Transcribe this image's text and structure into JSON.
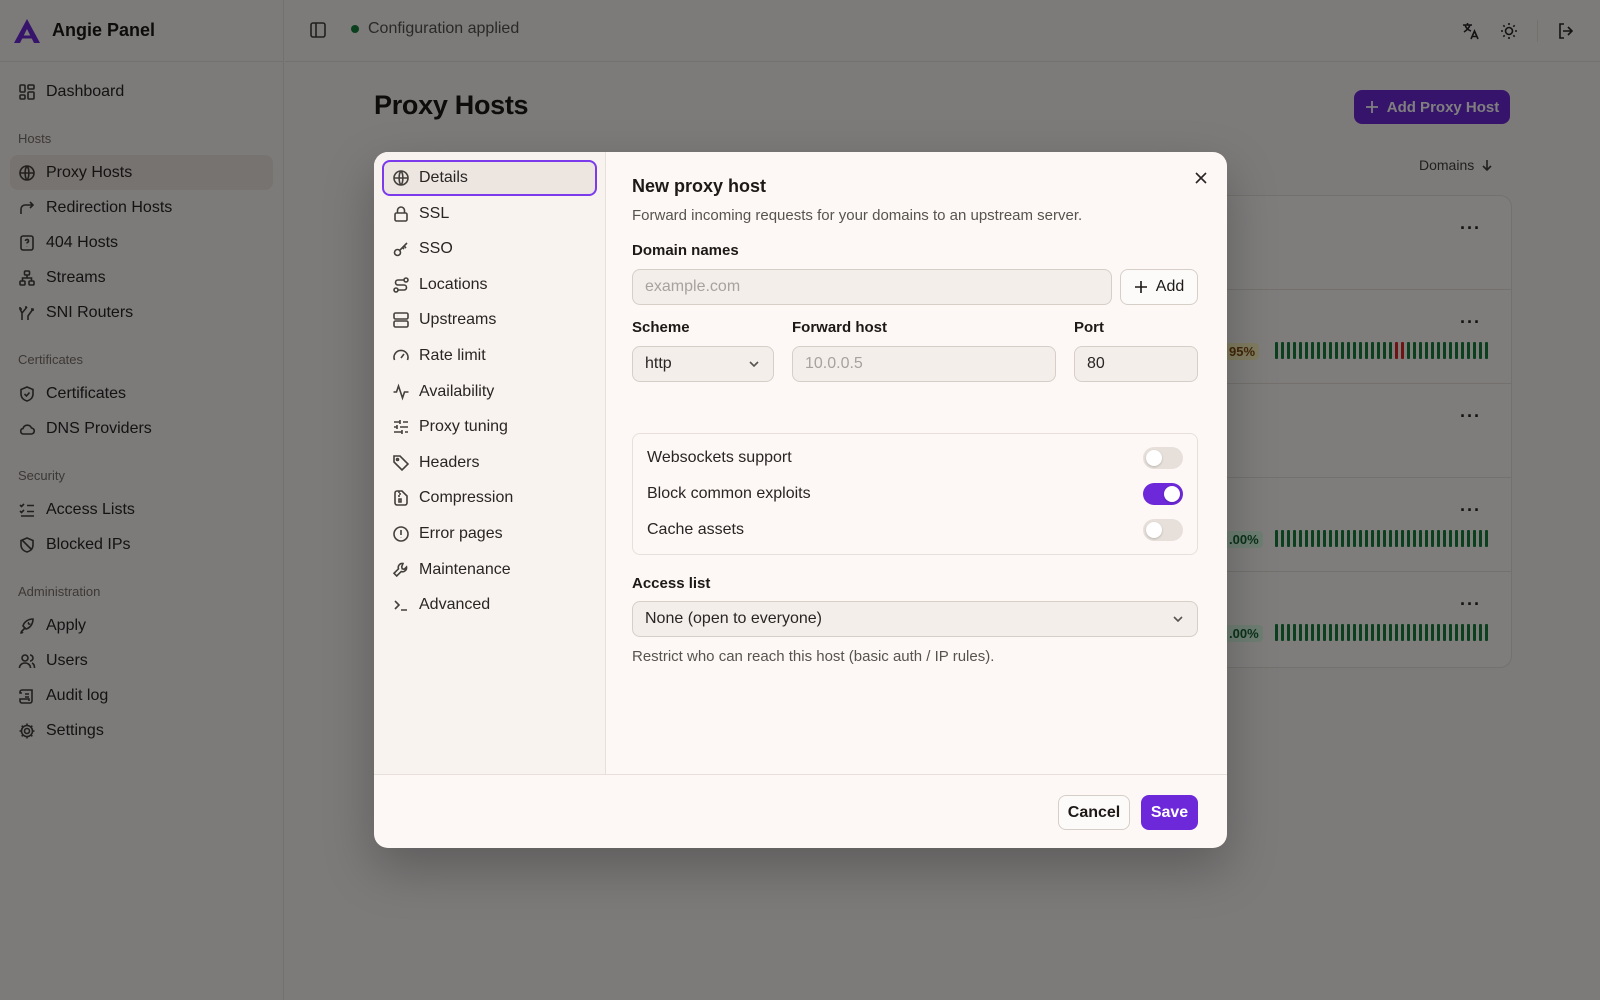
{
  "app": {
    "name": "Angie Panel"
  },
  "topbar": {
    "status": "Configuration applied"
  },
  "sidebar": {
    "dashboard": "Dashboard",
    "groups": [
      {
        "label": "Hosts",
        "items": [
          "Proxy Hosts",
          "Redirection Hosts",
          "404 Hosts",
          "Streams",
          "SNI Routers"
        ]
      },
      {
        "label": "Certificates",
        "items": [
          "Certificates",
          "DNS Providers"
        ]
      },
      {
        "label": "Security",
        "items": [
          "Access Lists",
          "Blocked IPs"
        ]
      },
      {
        "label": "Administration",
        "items": [
          "Apply",
          "Users",
          "Audit log",
          "Settings"
        ]
      }
    ]
  },
  "page": {
    "title": "Proxy Hosts",
    "add_button": "Add Proxy Host",
    "sort_label": "Domains",
    "rows": [
      {
        "pct": ""
      },
      {
        "pct": "95%"
      },
      {
        "pct": ""
      },
      {
        "pct": ".00%"
      },
      {
        "pct": ".00%"
      }
    ]
  },
  "modal": {
    "title": "New proxy host",
    "subtitle": "Forward incoming requests for your domains to an upstream server.",
    "tabs": [
      "Details",
      "SSL",
      "SSO",
      "Locations",
      "Upstreams",
      "Rate limit",
      "Availability",
      "Proxy tuning",
      "Headers",
      "Compression",
      "Error pages",
      "Maintenance",
      "Advanced"
    ],
    "active_tab": "Details",
    "domain_names": {
      "label": "Domain names",
      "placeholder": "example.com",
      "add_label": "Add"
    },
    "scheme": {
      "label": "Scheme",
      "value": "http"
    },
    "forward_host": {
      "label": "Forward host",
      "placeholder": "10.0.0.5"
    },
    "port": {
      "label": "Port",
      "value": "80"
    },
    "toggles": [
      {
        "label": "Websockets support",
        "on": false
      },
      {
        "label": "Block common exploits",
        "on": true
      },
      {
        "label": "Cache assets",
        "on": false
      }
    ],
    "access_list": {
      "label": "Access list",
      "value": "None (open to everyone)",
      "help": "Restrict who can reach this host (basic auth / IP rules)."
    },
    "cancel_label": "Cancel",
    "save_label": "Save"
  },
  "colors": {
    "accent": "#6d28d9",
    "status_ok": "#15803d",
    "status_bad": "#dc2626"
  }
}
